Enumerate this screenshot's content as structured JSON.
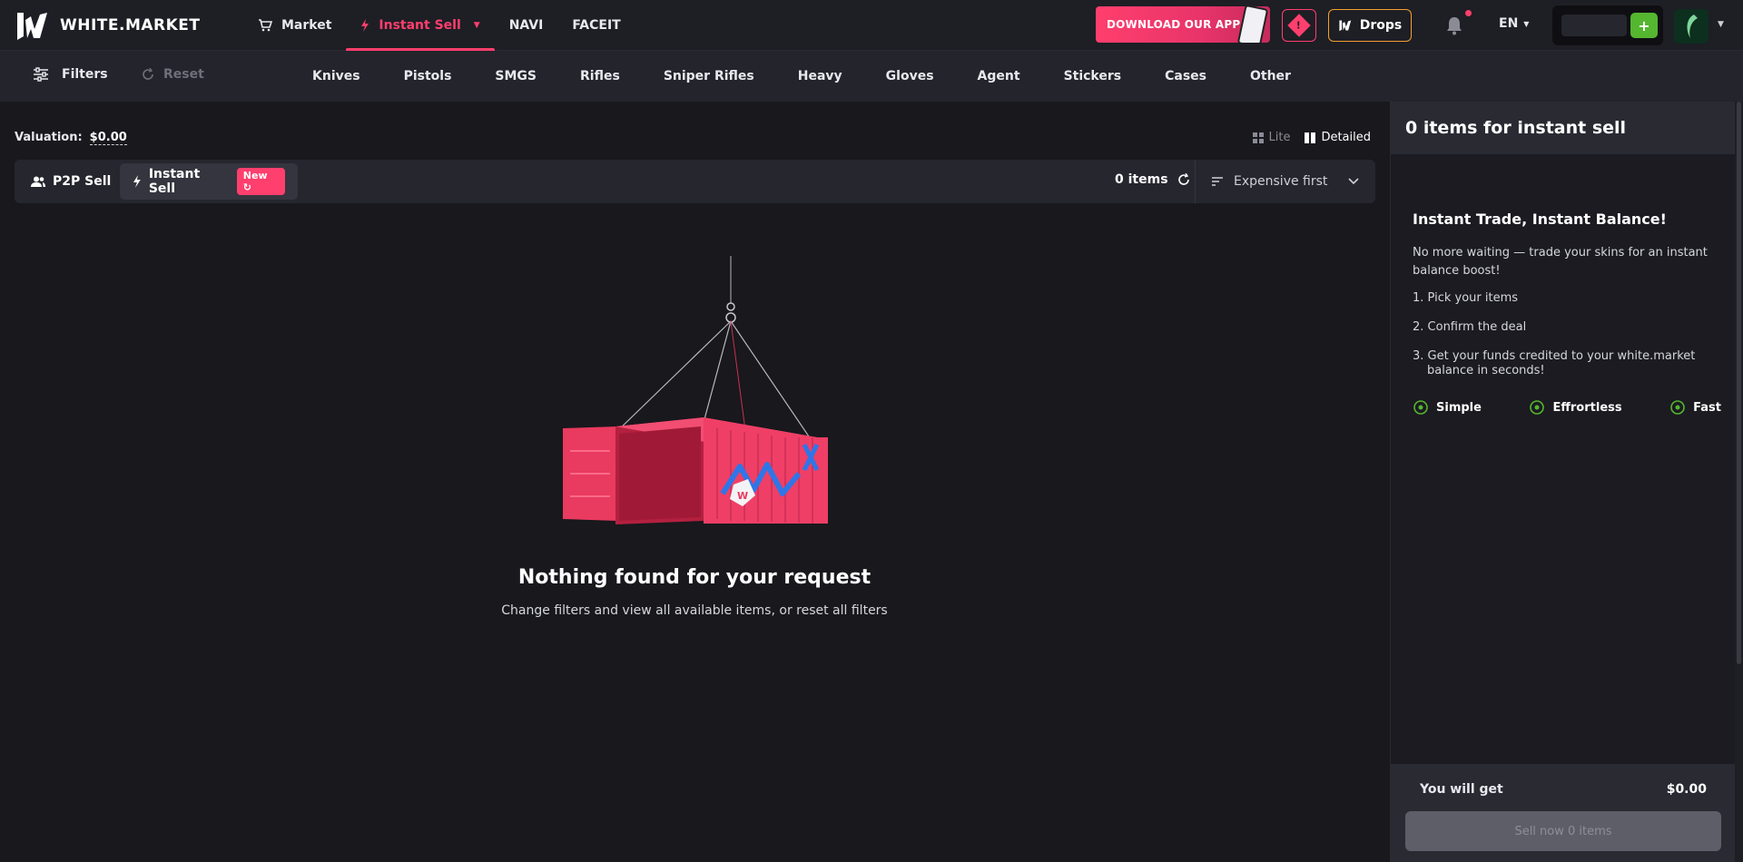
{
  "brand": {
    "name": "WHITE.MARKET"
  },
  "topnav": {
    "items": [
      {
        "label": "Market",
        "icon": "cart-icon"
      },
      {
        "label": "Instant Sell",
        "icon": "lightning-icon",
        "active": true
      },
      {
        "label": "NAVI"
      },
      {
        "label": "FACEIT"
      }
    ],
    "app_banner": "DOWNLOAD OUR APP",
    "drops_label": "Drops",
    "alert_symbol": "!",
    "language": "EN",
    "wallet_plus": "+"
  },
  "catbar": {
    "filters_label": "Filters",
    "reset_label": "Reset",
    "categories": [
      "Knives",
      "Pistols",
      "SMGS",
      "Rifles",
      "Sniper Rifles",
      "Heavy",
      "Gloves",
      "Agent",
      "Stickers",
      "Cases",
      "Other"
    ]
  },
  "main": {
    "valuation_label": "Valuation:",
    "valuation_value": "$0.00",
    "view_lite": "Lite",
    "view_detailed": "Detailed",
    "tab_p2p": "P2P Sell",
    "tab_instant": "Instant Sell",
    "badge_new": "New",
    "items_count": "0 items",
    "sort_label": "Expensive first",
    "empty_title": "Nothing found for your request",
    "empty_subtitle": "Change filters and view all available items, or reset all filters"
  },
  "panel": {
    "header": "0 items for instant sell",
    "promo_title": "Instant Trade, Instant Balance!",
    "promo_text": "No more waiting — trade your skins for an instant balance boost!",
    "steps": [
      "1. Pick your items",
      "2. Confirm the deal",
      "3. Get your funds credited to your white.market balance in seconds!"
    ],
    "features": [
      "Simple",
      "Effrortless",
      "Fast"
    ],
    "you_get_label": "You will get",
    "you_get_value": "$0.00",
    "sell_button": "Sell now 0 items"
  },
  "colors": {
    "accent": "#ff3f6d",
    "success": "#55b62f",
    "drops": "#f4a030",
    "feature": "#55b62f"
  }
}
